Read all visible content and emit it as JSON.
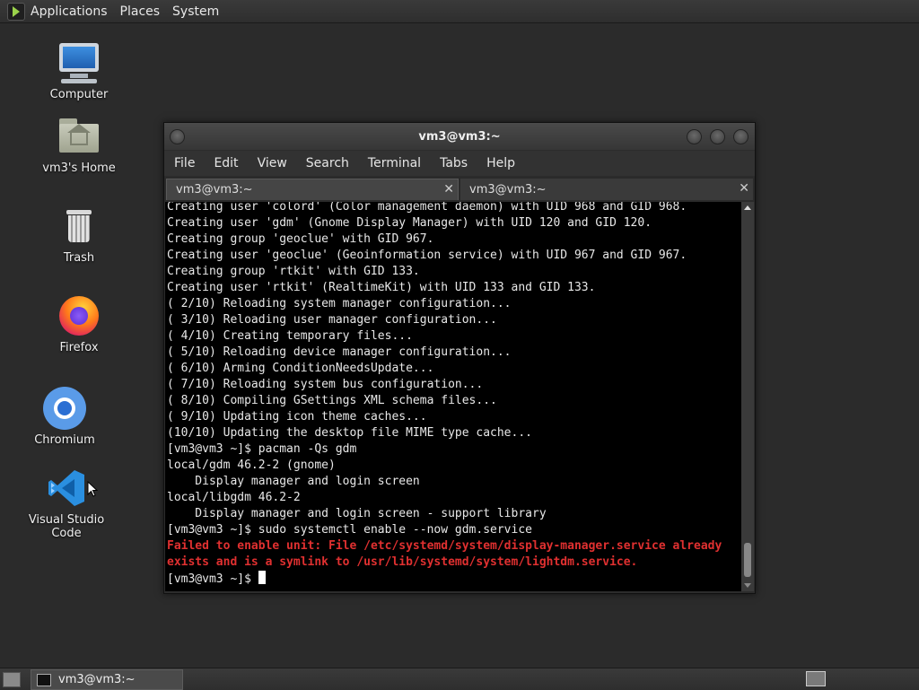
{
  "top_panel": {
    "menus": [
      "Applications",
      "Places",
      "System"
    ]
  },
  "desktop_icons": [
    {
      "label": "Computer",
      "icon": "computer-icon"
    },
    {
      "label": "vm3's Home",
      "icon": "home-folder-icon"
    },
    {
      "label": "Trash",
      "icon": "trash-icon"
    },
    {
      "label": "Firefox",
      "icon": "firefox-icon"
    },
    {
      "label": "Chromium",
      "icon": "chromium-icon"
    },
    {
      "label": "Visual Studio Code",
      "icon": "vscode-icon"
    }
  ],
  "terminal": {
    "title": "vm3@vm3:~",
    "menu": [
      "File",
      "Edit",
      "View",
      "Search",
      "Terminal",
      "Tabs",
      "Help"
    ],
    "tabs": [
      {
        "label": "vm3@vm3:~",
        "active": true
      },
      {
        "label": "vm3@vm3:~",
        "active": false
      }
    ],
    "lines": [
      {
        "text": "Creating user 'colord' (Color management daemon) with UID 968 and GID 968.",
        "error": false
      },
      {
        "text": "Creating user 'gdm' (Gnome Display Manager) with UID 120 and GID 120.",
        "error": false
      },
      {
        "text": "Creating group 'geoclue' with GID 967.",
        "error": false
      },
      {
        "text": "Creating user 'geoclue' (Geoinformation service) with UID 967 and GID 967.",
        "error": false
      },
      {
        "text": "Creating group 'rtkit' with GID 133.",
        "error": false
      },
      {
        "text": "Creating user 'rtkit' (RealtimeKit) with UID 133 and GID 133.",
        "error": false
      },
      {
        "text": "( 2/10) Reloading system manager configuration...",
        "error": false
      },
      {
        "text": "( 3/10) Reloading user manager configuration...",
        "error": false
      },
      {
        "text": "( 4/10) Creating temporary files...",
        "error": false
      },
      {
        "text": "( 5/10) Reloading device manager configuration...",
        "error": false
      },
      {
        "text": "( 6/10) Arming ConditionNeedsUpdate...",
        "error": false
      },
      {
        "text": "( 7/10) Reloading system bus configuration...",
        "error": false
      },
      {
        "text": "( 8/10) Compiling GSettings XML schema files...",
        "error": false
      },
      {
        "text": "( 9/10) Updating icon theme caches...",
        "error": false
      },
      {
        "text": "(10/10) Updating the desktop file MIME type cache...",
        "error": false
      },
      {
        "text": "[vm3@vm3 ~]$ pacman -Qs gdm",
        "error": false
      },
      {
        "text": "local/gdm 46.2-2 (gnome)",
        "error": false
      },
      {
        "text": "    Display manager and login screen",
        "error": false
      },
      {
        "text": "local/libgdm 46.2-2",
        "error": false
      },
      {
        "text": "    Display manager and login screen - support library",
        "error": false
      },
      {
        "text": "[vm3@vm3 ~]$ sudo systemctl enable --now gdm.service",
        "error": false
      },
      {
        "text": "Failed to enable unit: File /etc/systemd/system/display-manager.service already",
        "error": true
      },
      {
        "text": "exists and is a symlink to /usr/lib/systemd/system/lightdm.service.",
        "error": true
      }
    ],
    "prompt": "[vm3@vm3 ~]$ "
  },
  "taskbar": {
    "window_label": "vm3@vm3:~"
  }
}
